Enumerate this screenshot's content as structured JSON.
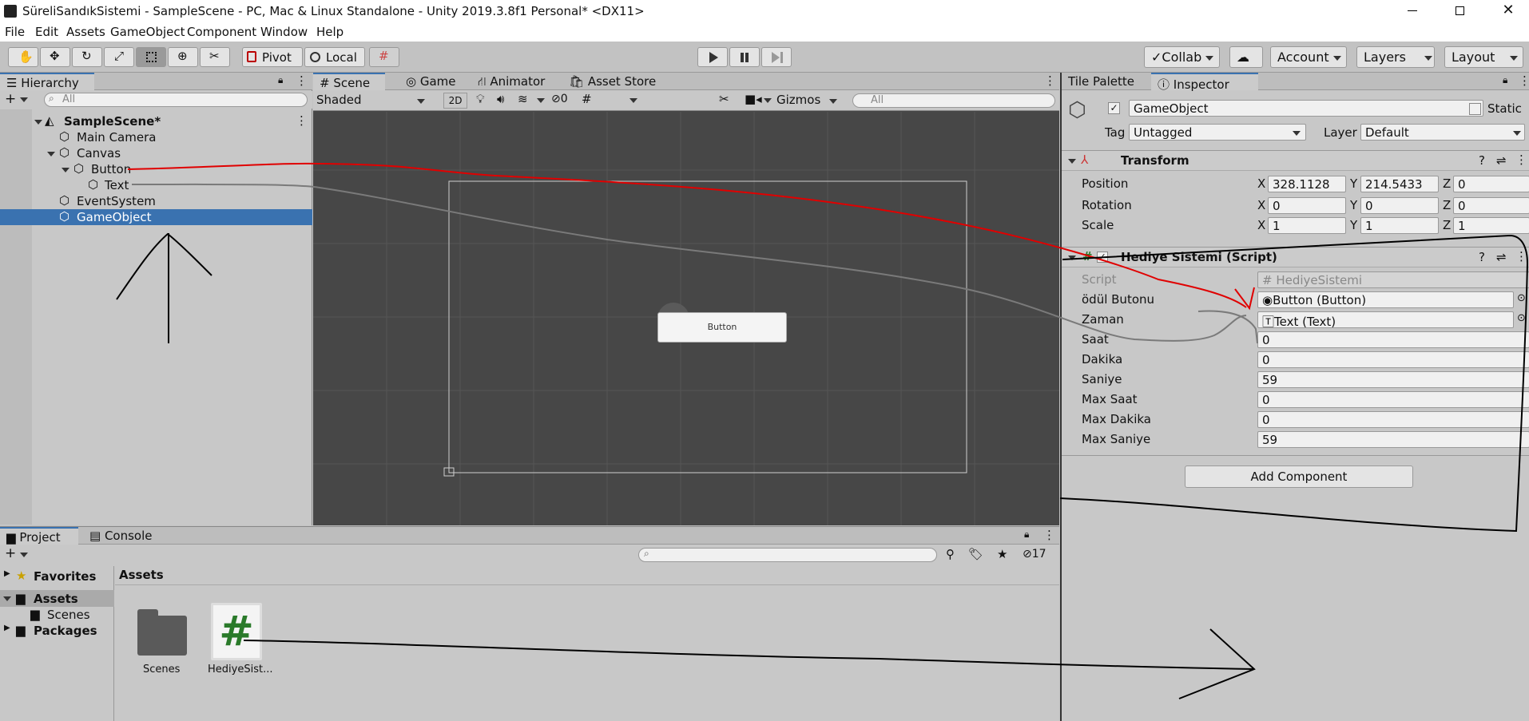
{
  "window": {
    "title": "SüreliSandıkSistemi - SampleScene - PC, Mac & Linux Standalone - Unity 2019.3.8f1 Personal* <DX11>",
    "icons": [
      "unity-logo-icon",
      "minimize-icon",
      "maximize-icon",
      "close-icon"
    ]
  },
  "menu": [
    "File",
    "Edit",
    "Assets",
    "GameObject",
    "Component",
    "Window",
    "Help"
  ],
  "toolbar": {
    "pivot": "Pivot",
    "local": "Local",
    "collab": "Collab",
    "account": "Account",
    "layers": "Layers",
    "layout": "Layout"
  },
  "hierarchy": {
    "tab": "Hierarchy",
    "search_placeholder": "All",
    "scene_name": "SampleScene*",
    "items": [
      "Main Camera",
      "Canvas",
      "Button",
      "Text",
      "EventSystem",
      "GameObject"
    ],
    "selected": "GameObject"
  },
  "scene": {
    "tabs": [
      "Scene",
      "Game",
      "Animator",
      "Asset Store"
    ],
    "shading": "Shaded",
    "mode_2d": "2D",
    "hidden_count": "0",
    "gizmos": "Gizmos",
    "search_placeholder": "All",
    "button_label": "Button"
  },
  "inspector": {
    "tabs": [
      "Tile Palette",
      "Inspector"
    ],
    "object_name": "GameObject",
    "static_label": "Static",
    "tag_label": "Tag",
    "tag_value": "Untagged",
    "layer_label": "Layer",
    "layer_value": "Default",
    "transform": {
      "title": "Transform",
      "position": {
        "label": "Position",
        "x": "328.1128",
        "y": "214.5433",
        "z": "0"
      },
      "rotation": {
        "label": "Rotation",
        "x": "0",
        "y": "0",
        "z": "0"
      },
      "scale": {
        "label": "Scale",
        "x": "1",
        "y": "1",
        "z": "1"
      },
      "axis_labels": [
        "X",
        "Y",
        "Z"
      ]
    },
    "script_component": {
      "title": "Hediye Sistemi (Script)",
      "fields": [
        {
          "label": "Script",
          "value": "HediyeSistemi"
        },
        {
          "label": "ödül Butonu",
          "value": "Button (Button)"
        },
        {
          "label": "Zaman",
          "value": "Text (Text)"
        },
        {
          "label": "Saat",
          "value": "0"
        },
        {
          "label": "Dakika",
          "value": "0"
        },
        {
          "label": "Saniye",
          "value": "59"
        },
        {
          "label": "Max Saat",
          "value": "0"
        },
        {
          "label": "Max Dakika",
          "value": "0"
        },
        {
          "label": "Max Saniye",
          "value": "59"
        }
      ]
    },
    "add_component": "Add Component"
  },
  "project": {
    "tabs": [
      "Project",
      "Console"
    ],
    "hidden_count": "17",
    "sidebar": [
      "Favorites",
      "Assets",
      "Scenes",
      "Packages"
    ],
    "breadcrumb": "Assets",
    "assets": [
      {
        "name": "Scenes",
        "icon": "folder-icon"
      },
      {
        "name": "HediyeSist...",
        "icon": "csharp-script-icon"
      }
    ]
  },
  "annotation_colors": {
    "red": "#e00000",
    "gray": "#7a7a7a",
    "black": "#000000"
  }
}
